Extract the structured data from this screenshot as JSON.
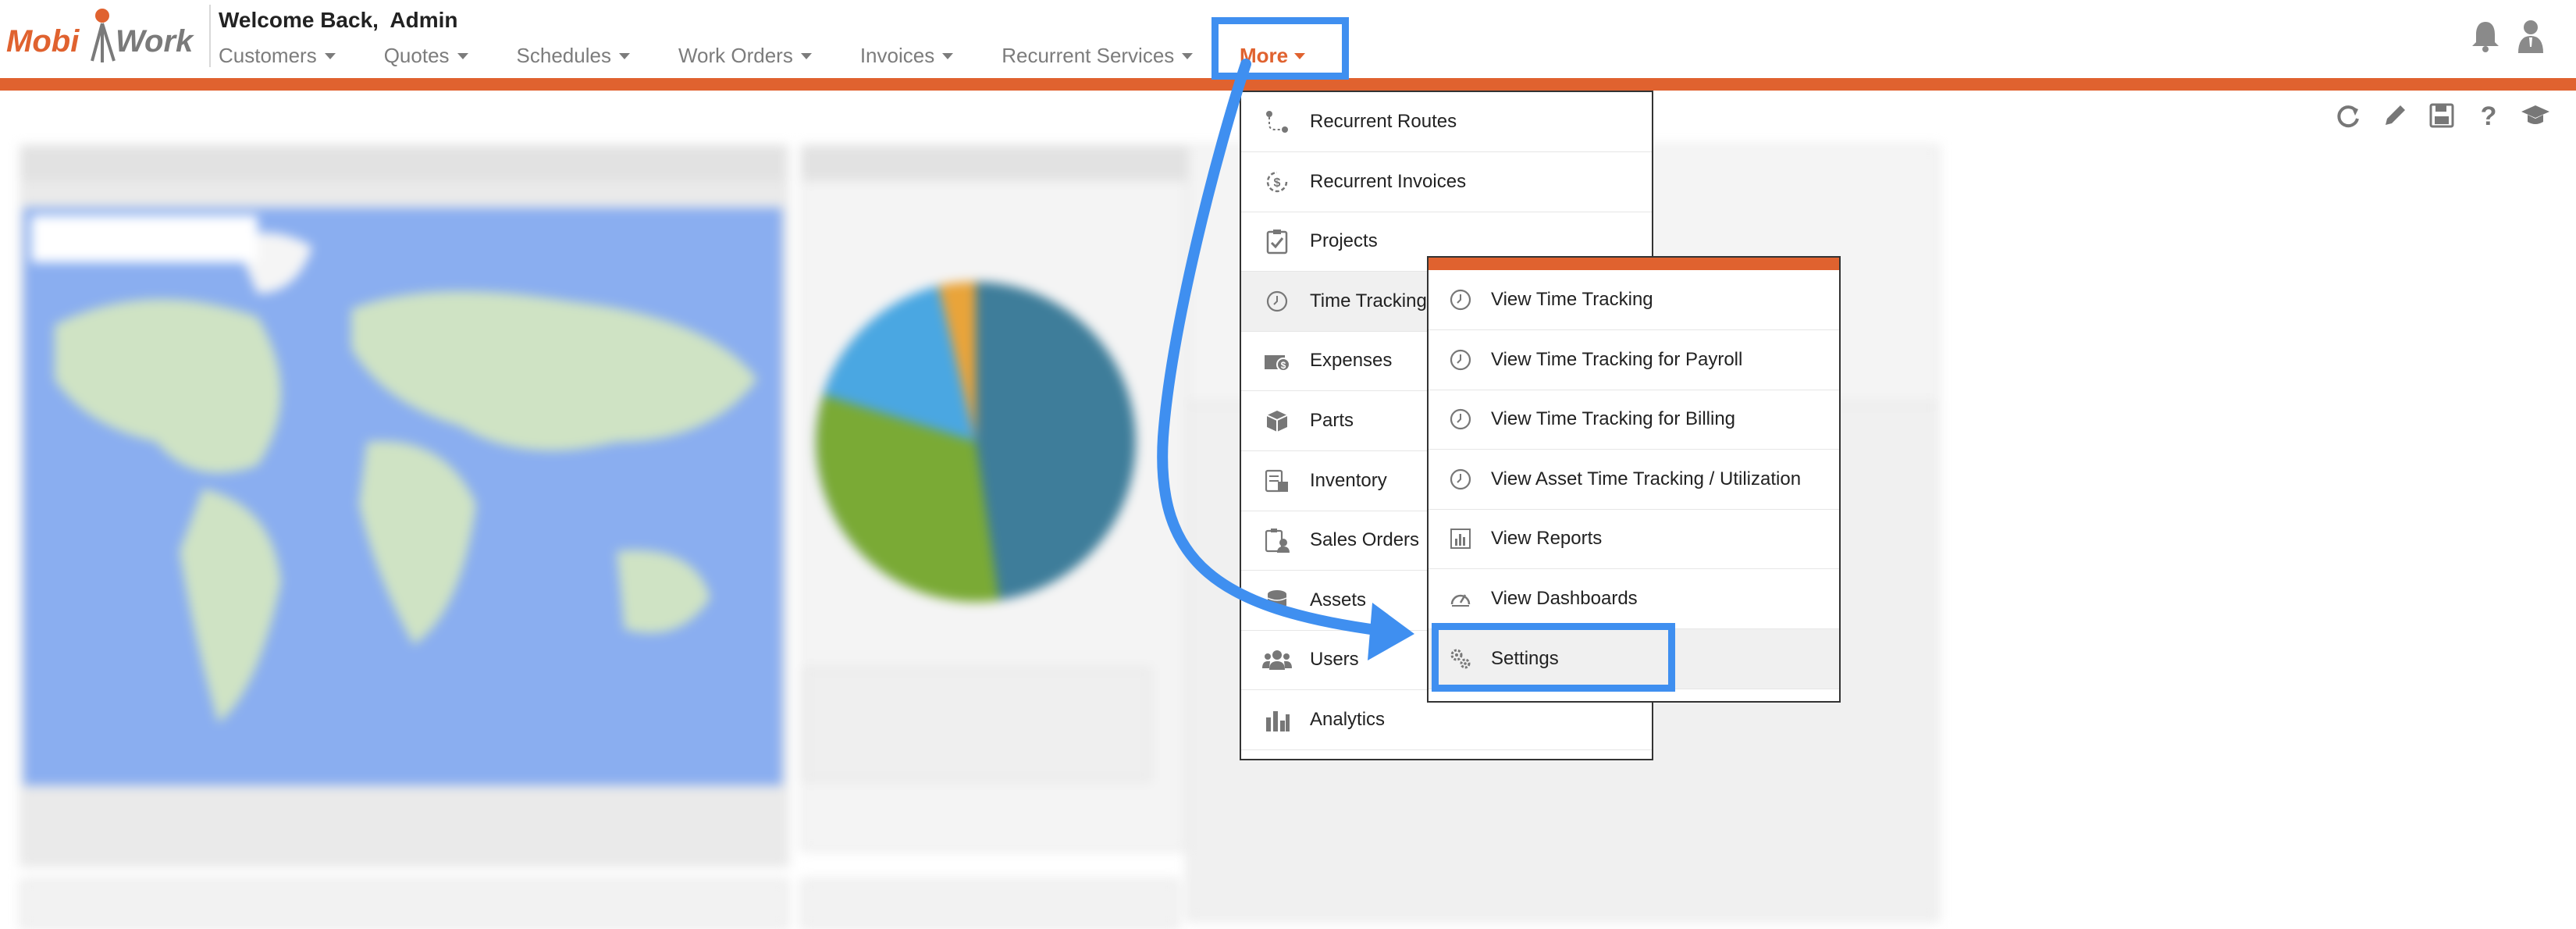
{
  "header": {
    "logo_text": "MobiWork",
    "welcome": "Welcome Back,  Admin"
  },
  "nav": {
    "items": [
      {
        "label": "Customers"
      },
      {
        "label": "Quotes"
      },
      {
        "label": "Schedules"
      },
      {
        "label": "Work Orders"
      },
      {
        "label": "Invoices"
      },
      {
        "label": "Recurrent Services"
      }
    ],
    "more_label": "More"
  },
  "top_icons": [
    "bell-icon",
    "user-icon"
  ],
  "toolbar_icons": [
    "refresh-icon",
    "pencil-icon",
    "save-icon",
    "help-icon",
    "graduation-cap-icon"
  ],
  "more_menu": {
    "items": [
      {
        "label": "Recurrent Routes",
        "icon": "route-icon"
      },
      {
        "label": "Recurrent Invoices",
        "icon": "recurrent-dollar-icon"
      },
      {
        "label": "Projects",
        "icon": "clipboard-check-icon"
      },
      {
        "label": "Time Tracking",
        "icon": "clock-icon"
      },
      {
        "label": "Expenses",
        "icon": "money-icon"
      },
      {
        "label": "Parts",
        "icon": "cube-icon"
      },
      {
        "label": "Inventory",
        "icon": "inventory-icon"
      },
      {
        "label": "Sales Orders",
        "icon": "sales-orders-icon"
      },
      {
        "label": "Assets",
        "icon": "coins-icon"
      },
      {
        "label": "Users",
        "icon": "users-icon"
      },
      {
        "label": "Analytics",
        "icon": "bar-chart-icon"
      }
    ]
  },
  "time_tracking_submenu": {
    "items": [
      {
        "label": "View Time Tracking",
        "icon": "clock-icon"
      },
      {
        "label": "View Time Tracking for Payroll",
        "icon": "clock-icon"
      },
      {
        "label": "View Time Tracking for Billing",
        "icon": "clock-icon"
      },
      {
        "label": "View Asset Time Tracking / Utilization",
        "icon": "clock-icon"
      },
      {
        "label": "View Reports",
        "icon": "report-chart-icon"
      },
      {
        "label": "View Dashboards",
        "icon": "gauge-icon"
      },
      {
        "label": "Settings",
        "icon": "gears-icon"
      }
    ]
  },
  "colors": {
    "accent_orange": "#e0622f",
    "highlight_blue": "#3f8ff0",
    "pie_teal": "#3e7d9a",
    "pie_green": "#7aaa35",
    "pie_blue": "#4aa7e2",
    "pie_orange": "#e9a43a",
    "map_water": "#8aaef0",
    "map_land": "#cfe3c4"
  }
}
